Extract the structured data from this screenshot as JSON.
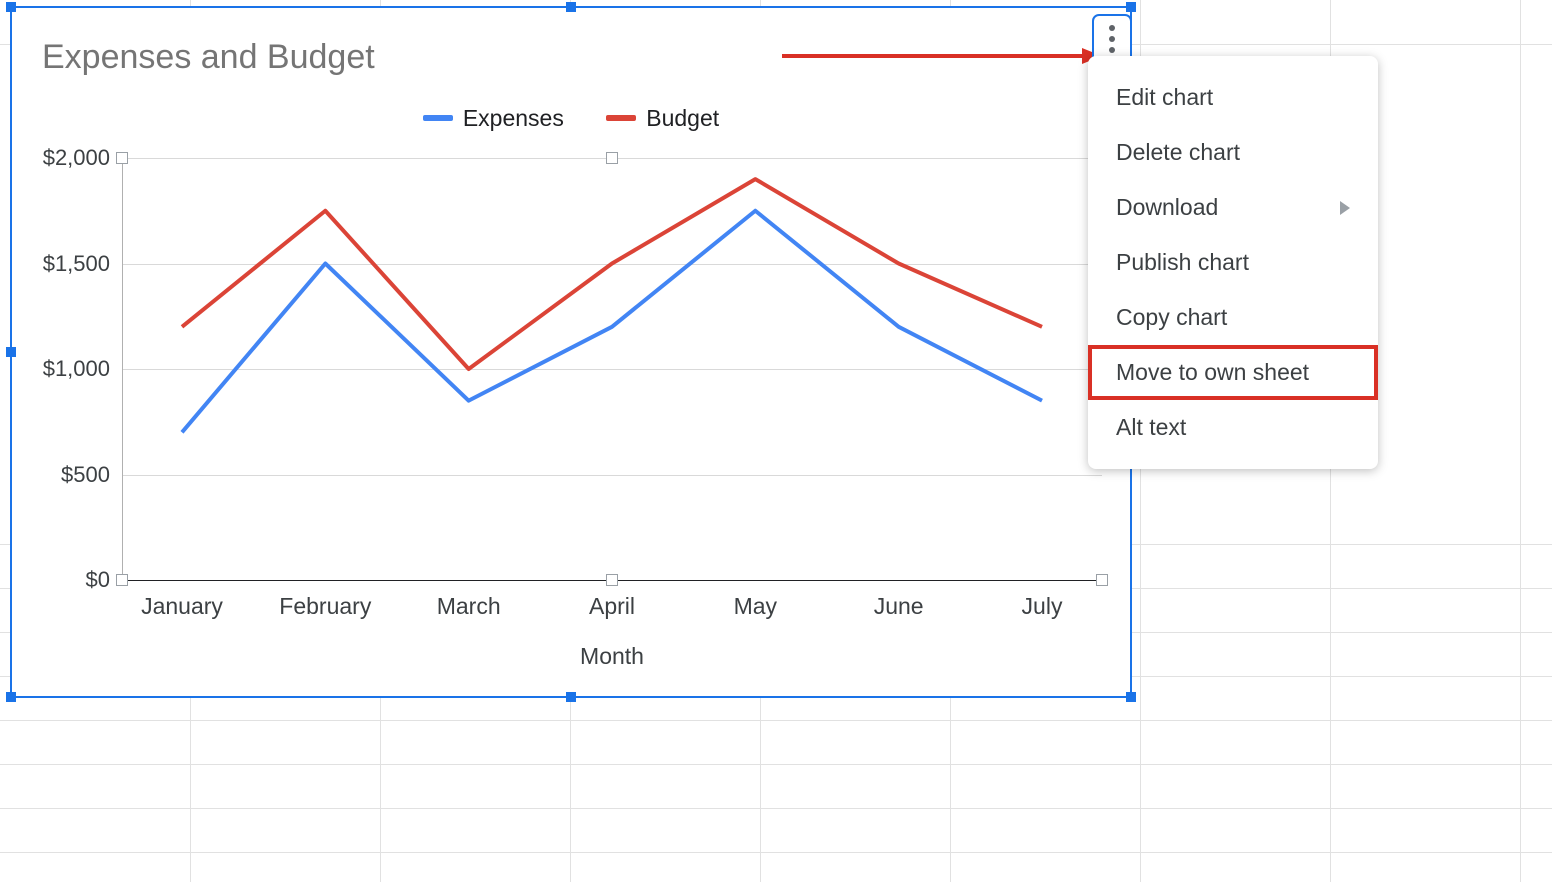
{
  "chart_data": {
    "type": "line",
    "title": "Expenses and Budget",
    "xlabel": "Month",
    "ylabel": "",
    "categories": [
      "January",
      "February",
      "March",
      "April",
      "May",
      "June",
      "July"
    ],
    "series": [
      {
        "name": "Expenses",
        "color": "#4285f4",
        "values": [
          700,
          1500,
          850,
          1200,
          1750,
          1200,
          850
        ]
      },
      {
        "name": "Budget",
        "color": "#db4437",
        "values": [
          1200,
          1750,
          1000,
          1500,
          1900,
          1500,
          1200
        ]
      }
    ],
    "ylim": [
      0,
      2000
    ],
    "y_ticks": [
      0,
      500,
      1000,
      1500,
      2000
    ],
    "y_tick_labels": [
      "$0",
      "$500",
      "$1,000",
      "$1,500",
      "$2,000"
    ]
  },
  "context_menu": {
    "items": [
      {
        "label": "Edit chart",
        "submenu": false,
        "highlight": false
      },
      {
        "label": "Delete chart",
        "submenu": false,
        "highlight": false
      },
      {
        "label": "Download",
        "submenu": true,
        "highlight": false
      },
      {
        "label": "Publish chart",
        "submenu": false,
        "highlight": false
      },
      {
        "label": "Copy chart",
        "submenu": false,
        "highlight": false
      },
      {
        "label": "Move to own sheet",
        "submenu": false,
        "highlight": true
      },
      {
        "label": "Alt text",
        "submenu": false,
        "highlight": false
      }
    ]
  }
}
